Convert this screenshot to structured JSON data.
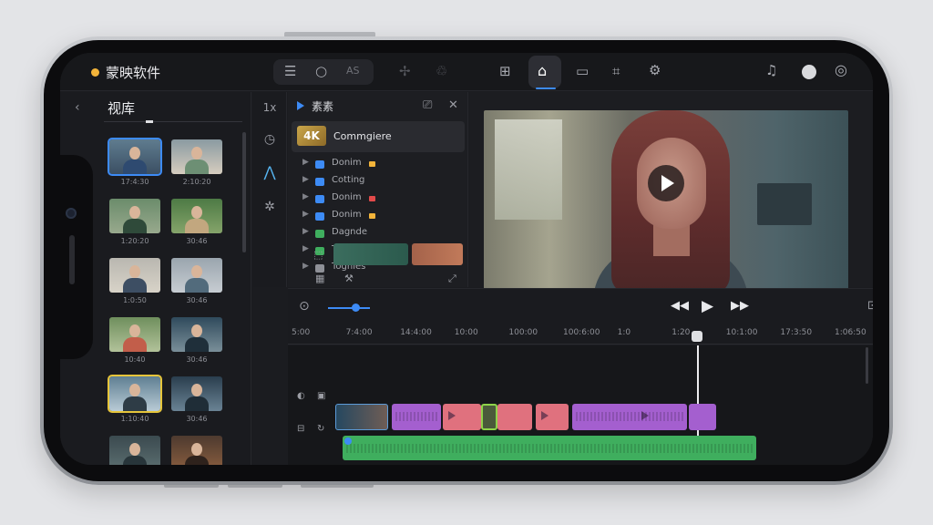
{
  "app": {
    "title": "蒙映软件"
  },
  "topbar": {
    "group_icons": [
      "list-icon",
      "circle-icon",
      "ai-icon"
    ],
    "group_ai_label": "AS",
    "icons": [
      "magic-icon",
      "recycle-icon",
      "grid-icon",
      "home-icon",
      "screen-icon",
      "crop-icon",
      "settings-gear-icon",
      "bell-icon",
      "avatar-icon",
      "compass-icon"
    ]
  },
  "library": {
    "title": "视库",
    "back_icon": "‹",
    "thumbnails": [
      {
        "label": "17:4:30",
        "selected": "blue"
      },
      {
        "label": "2:10:20",
        "selected": ""
      },
      {
        "label": "1:20:20",
        "selected": ""
      },
      {
        "label": "30:46",
        "selected": ""
      },
      {
        "label": "1:0:50",
        "selected": ""
      },
      {
        "label": "30:46",
        "selected": ""
      },
      {
        "label": "10:40",
        "selected": ""
      },
      {
        "label": "30:46",
        "selected": ""
      },
      {
        "label": "1:10:40",
        "selected": "yellow"
      },
      {
        "label": "30:46",
        "selected": ""
      },
      {
        "label": "",
        "selected": ""
      },
      {
        "label": "",
        "selected": ""
      }
    ]
  },
  "tools": {
    "label_1x": "1x"
  },
  "media": {
    "title": "素素",
    "badge": "4K",
    "folder_name": "Commgiere",
    "folders": [
      {
        "name": "Donim",
        "icon_color": "#3d8bf5",
        "mark_color": "#f3b43a"
      },
      {
        "name": "Cotting",
        "icon_color": "#3d8bf5",
        "mark_color": ""
      },
      {
        "name": "Donim",
        "icon_color": "#3d8bf5",
        "mark_color": "#e24a4a"
      },
      {
        "name": "Donim",
        "icon_color": "#3d8bf5",
        "mark_color": "#f3b43a"
      },
      {
        "name": "Dagnde",
        "icon_color": "#3fae5e",
        "mark_color": ""
      },
      {
        "name": "Tearanar",
        "icon_color": "#3fae5e",
        "mark_color": ""
      },
      {
        "name": "Toghies",
        "icon_color": "#8e9097",
        "mark_color": ""
      }
    ]
  },
  "preview": {
    "progress": 0.35
  },
  "timeline": {
    "ruler_labels": [
      "5:00",
      "7:4:00",
      "14:4:00",
      "10:00",
      "100:00",
      "100:6:00",
      "1:0",
      "1:20",
      "10:1:00",
      "17:3:50",
      "1:06:50"
    ]
  },
  "colors": {
    "accent": "#3d8bf5",
    "purple": "#a45fcf",
    "pink": "#e0717e",
    "green": "#3fae5e",
    "yellow": "#f3b43a"
  }
}
